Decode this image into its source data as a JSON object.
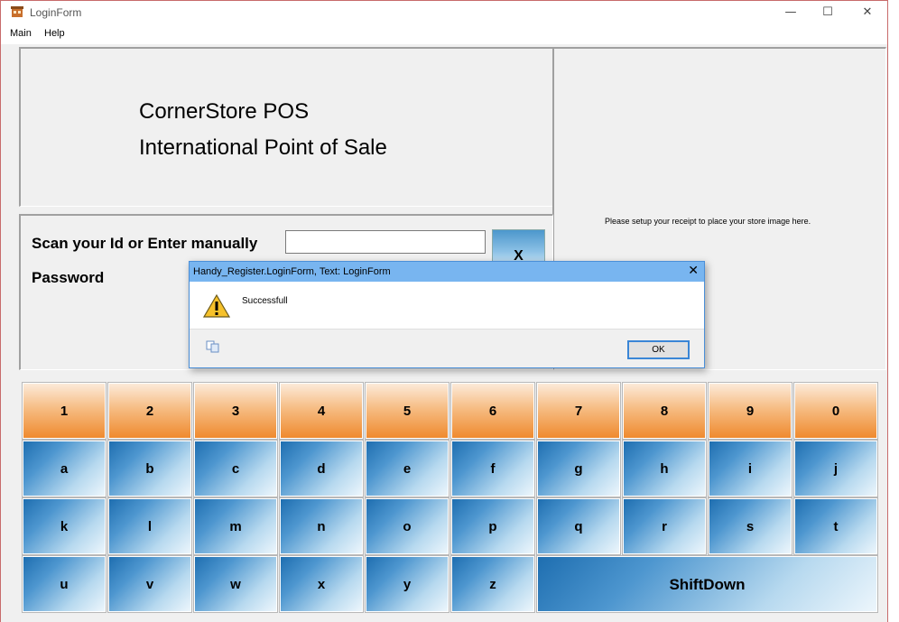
{
  "window": {
    "title": "LoginForm",
    "icon": "register-icon"
  },
  "titlebar_buttons": {
    "minimize": "—",
    "maximize": "☐",
    "close": "✕"
  },
  "menu": {
    "items": [
      "Main",
      "Help"
    ]
  },
  "brand": {
    "line1": "CornerStore POS",
    "line2": "International Point of Sale"
  },
  "receipt_panel": {
    "message": "Please setup your receipt to place your store image here."
  },
  "login": {
    "id_label": "Scan your Id or Enter manually",
    "id_value": "",
    "password_label": "Password",
    "clear_label": "X"
  },
  "keypad": {
    "row1": [
      "1",
      "2",
      "3",
      "4",
      "5",
      "6",
      "7",
      "8",
      "9",
      "0"
    ],
    "row2": [
      "a",
      "b",
      "c",
      "d",
      "e",
      "f",
      "g",
      "h",
      "i",
      "j"
    ],
    "row3": [
      "k",
      "l",
      "m",
      "n",
      "o",
      "p",
      "q",
      "r",
      "s",
      "t"
    ],
    "row4": [
      "u",
      "v",
      "w",
      "x",
      "y",
      "z"
    ],
    "shift_label": "ShiftDown"
  },
  "dialog": {
    "title": "Handy_Register.LoginForm, Text: LoginForm",
    "close": "✕",
    "message": "Successfull",
    "icon": "warning-icon",
    "ok_label": "OK"
  },
  "colors": {
    "numeric_key": "#f6bd84",
    "alpha_key": "#4d96cf",
    "dialog_title": "#78b5f0",
    "ok_border": "#3a86d6"
  }
}
